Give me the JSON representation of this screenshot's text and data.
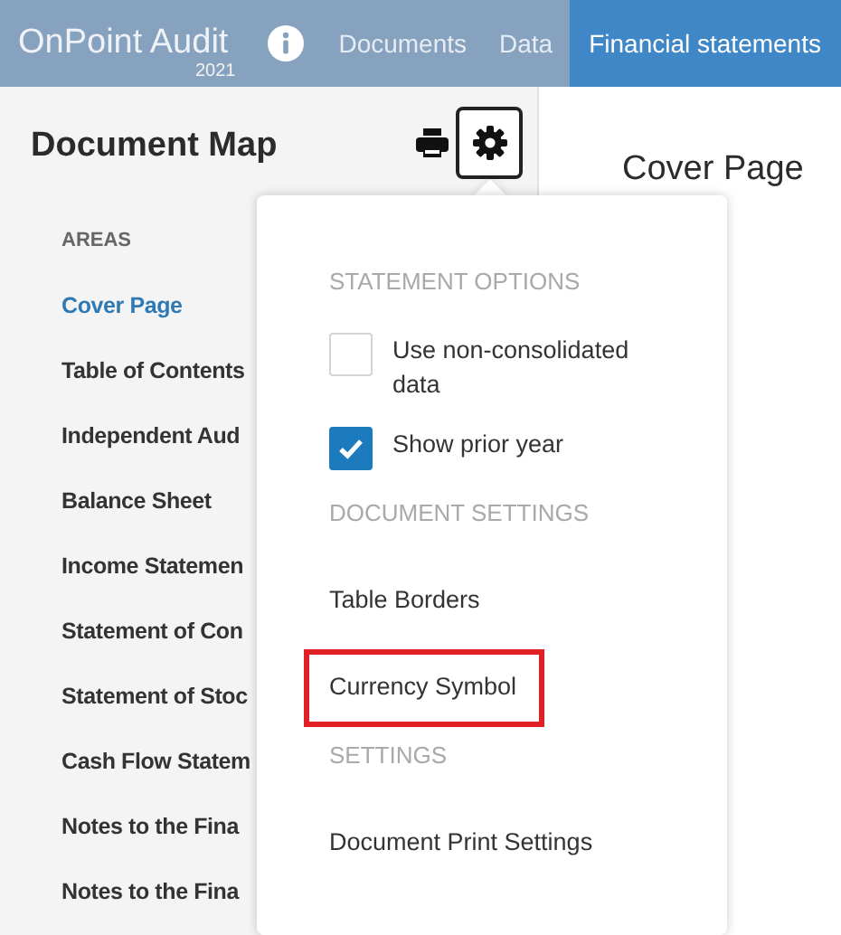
{
  "app": {
    "title": "OnPoint Audit",
    "year": "2021"
  },
  "nav": [
    {
      "label": "Documents",
      "selected": false
    },
    {
      "label": "Data",
      "selected": false
    },
    {
      "label": "Financial statements",
      "selected": true
    }
  ],
  "sidebar": {
    "title": "Document Map",
    "section": "AREAS",
    "items": [
      {
        "label": "Cover Page",
        "selected": true
      },
      {
        "label": "Table of Contents",
        "selected": false
      },
      {
        "label": "Independent Aud",
        "selected": false
      },
      {
        "label": "Balance Sheet",
        "selected": false
      },
      {
        "label": "Income Statemen",
        "selected": false
      },
      {
        "label": "Statement of Con",
        "selected": false
      },
      {
        "label": "Statement of Stoc",
        "selected": false
      },
      {
        "label": "Cash Flow Statem",
        "selected": false
      },
      {
        "label": "Notes to the Fina",
        "selected": false
      },
      {
        "label": "Notes to the Fina",
        "selected": false
      }
    ]
  },
  "content": {
    "title": "Cover Page"
  },
  "menu": [
    {
      "kind": "heading",
      "label": "STATEMENT OPTIONS"
    },
    {
      "kind": "checkbox",
      "label": "Use non-consolidated data",
      "checked": false
    },
    {
      "kind": "checkbox",
      "label": "Show prior year",
      "checked": true
    },
    {
      "kind": "heading",
      "label": "DOCUMENT SETTINGS"
    },
    {
      "kind": "item",
      "label": "Table Borders",
      "highlighted": false
    },
    {
      "kind": "item",
      "label": "Currency Symbol",
      "highlighted": true
    },
    {
      "kind": "heading",
      "label": "SETTINGS"
    },
    {
      "kind": "item",
      "label": "Document Print Settings",
      "highlighted": false
    }
  ]
}
